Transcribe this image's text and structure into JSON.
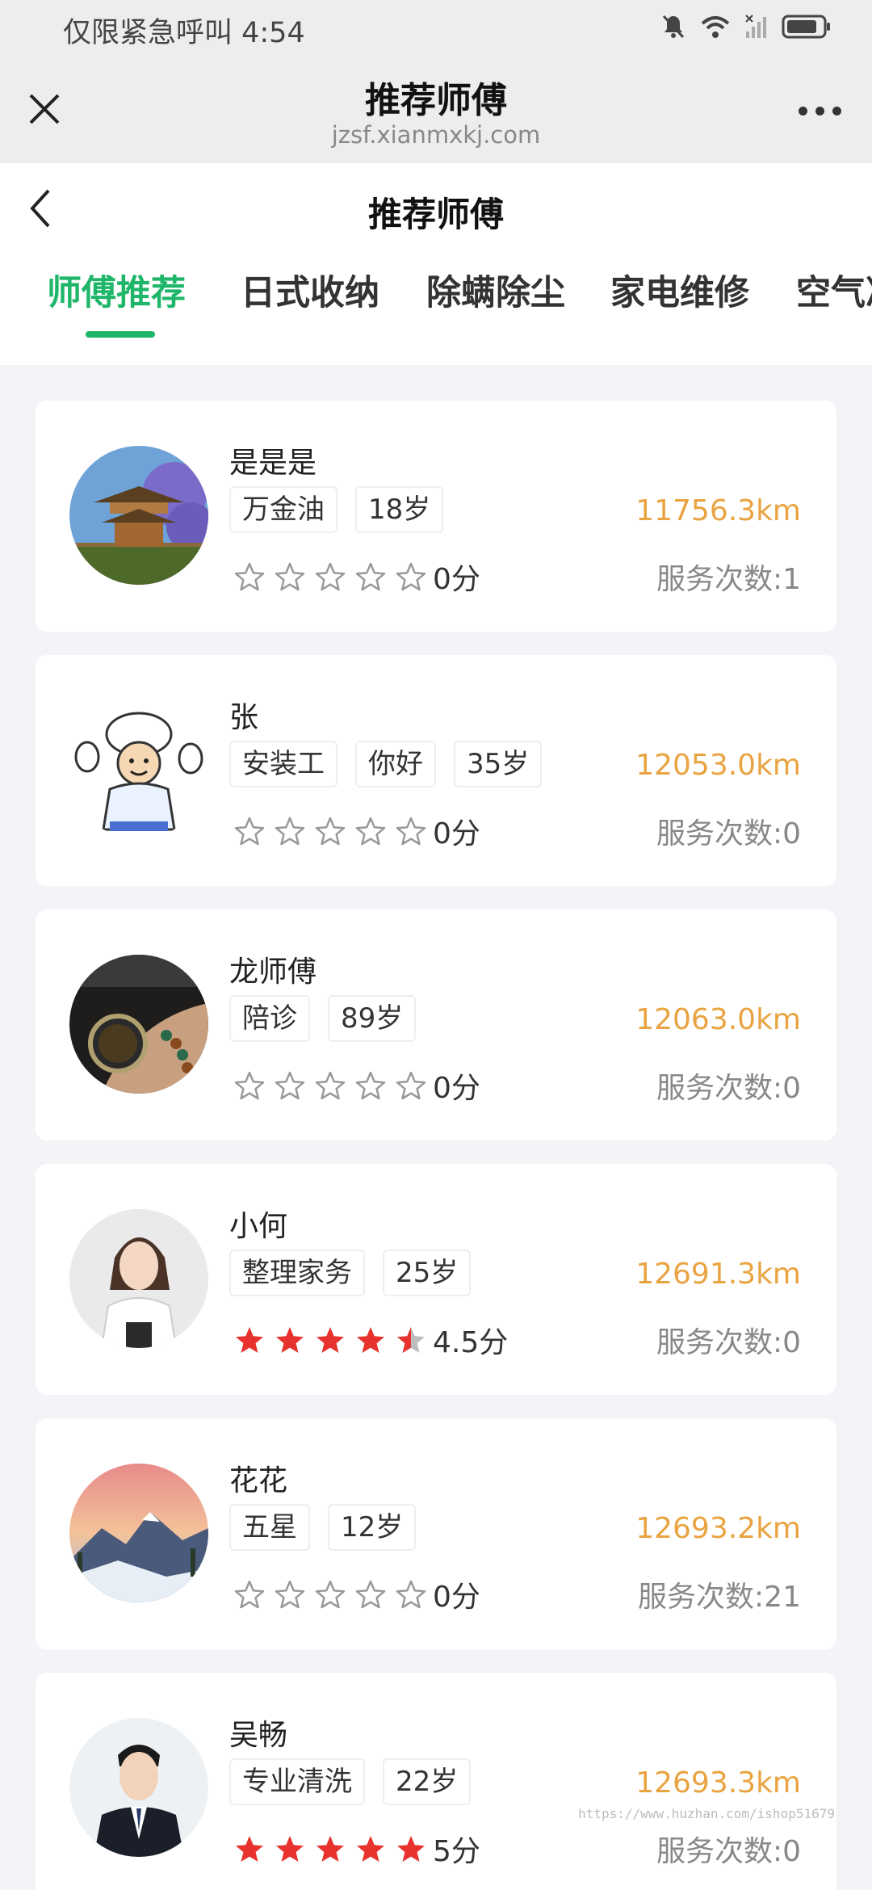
{
  "status_bar": {
    "text": "仅限紧急呼叫 4:54"
  },
  "wechat_bar": {
    "title": "推荐师傅",
    "domain": "jzsf.xianmxkj.com"
  },
  "header": {
    "title": "推荐师傅"
  },
  "tabs": [
    {
      "label": "师傅推荐",
      "active": true
    },
    {
      "label": "日式收纳",
      "active": false
    },
    {
      "label": "除螨除尘",
      "active": false
    },
    {
      "label": "家电维修",
      "active": false
    },
    {
      "label": "空气净",
      "active": false
    }
  ],
  "workers": [
    {
      "name": "是是是",
      "tags": [
        "万金油",
        "18岁"
      ],
      "score_text": "0分",
      "rating": 0,
      "distance": "11756.3km",
      "service_count": "服务次数:1",
      "avatar": "pagoda-avatar"
    },
    {
      "name": "张",
      "tags": [
        "安装工",
        "你好",
        "35岁"
      ],
      "score_text": "0分",
      "rating": 0,
      "distance": "12053.0km",
      "service_count": "服务次数:0",
      "avatar": "chef-cartoon-avatar"
    },
    {
      "name": "龙师傅",
      "tags": [
        "陪诊",
        "89岁"
      ],
      "score_text": "0分",
      "rating": 0,
      "distance": "12063.0km",
      "service_count": "服务次数:0",
      "avatar": "watch-avatar"
    },
    {
      "name": "小何",
      "tags": [
        "整理家务",
        "25岁"
      ],
      "score_text": "4.5分",
      "rating": 4.5,
      "distance": "12691.3km",
      "service_count": "服务次数:0",
      "avatar": "woman-portrait-avatar"
    },
    {
      "name": "花花",
      "tags": [
        "五星",
        "12岁"
      ],
      "score_text": "0分",
      "rating": 0,
      "distance": "12693.2km",
      "service_count": "服务次数:21",
      "avatar": "mountain-avatar"
    },
    {
      "name": "吴畅",
      "tags": [
        "专业清洗",
        "22岁"
      ],
      "score_text": "5分",
      "rating": 5,
      "distance": "12693.3km",
      "service_count": "服务次数:0",
      "avatar": "man-suit-avatar"
    }
  ],
  "watermark": "https://www.huzhan.com/ishop51679",
  "colors": {
    "accent": "#1fb66a",
    "distance": "#e9a340",
    "star_filled": "#e8322d",
    "star_empty": "#999999"
  }
}
